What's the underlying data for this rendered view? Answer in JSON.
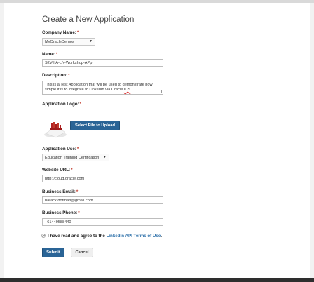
{
  "form": {
    "title": "Create a New Application",
    "required_marker": "*",
    "company": {
      "label": "Company Name:",
      "selected": "MyOracleDemos"
    },
    "name": {
      "label": "Name:",
      "value": "S2V-IIA-LN-Workshop-APp"
    },
    "description": {
      "label": "Description:",
      "value_line1": "This is a Test Application that will be used to demonstrate how",
      "value_line2_prefix": "simple it is to integrate to LinkedIn via Oracle ",
      "value_line2_suffix": "ICS"
    },
    "logo": {
      "label": "Application Logo:",
      "upload_button": "Select File to Upload"
    },
    "use": {
      "label": "Application Use:",
      "selected": "Education Training Certification"
    },
    "website": {
      "label": "Website URL:",
      "value": "http://cloud.oracle.com"
    },
    "email": {
      "label": "Business Email:",
      "value": "barack.dorman@gmail.com"
    },
    "phone": {
      "label": "Business Phone:",
      "value": "+61449588440"
    },
    "terms": {
      "prefix": "I have read and agree to the ",
      "link": "LinkedIn API Terms of Use",
      "suffix": ".",
      "checked": true
    },
    "submit_label": "Submit",
    "cancel_label": "Cancel"
  },
  "colors": {
    "primary_button": "#2a6496",
    "link": "#2a6ea8",
    "required": "#c0392b"
  },
  "icons": {
    "dropdown": "chevron-down-icon",
    "logo": "application-logo-image",
    "checkbox": "check-icon"
  }
}
